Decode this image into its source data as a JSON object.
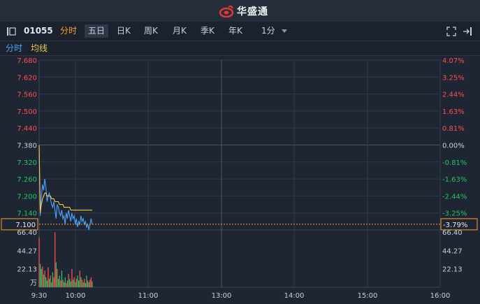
{
  "brand": {
    "name": "华盛通",
    "logo": "huasheng-logo-icon"
  },
  "toolbar": {
    "collapse_icon": "panel-collapse-icon",
    "stock_code": "01055",
    "periods": [
      "分时",
      "五日",
      "日K",
      "周K",
      "月K",
      "季K",
      "年K"
    ],
    "active_period": "分时",
    "highlight_period": "五日",
    "interval": "1分",
    "interval_arrow": "chevron-down-icon",
    "fullscreen_icon": "fullscreen-icon",
    "popout_icon": "popout-icon"
  },
  "subtabs": {
    "timeshare": "分时",
    "avg_line": "均线"
  },
  "colors": {
    "background": "#1e2633",
    "price_line": "#4da3ff",
    "avg_line": "#f2c94c",
    "up": "#ff4d4f",
    "down": "#22c55e",
    "ref_line": "#ff9d2e",
    "grid": "#2f3a4a"
  },
  "chart_data": {
    "type": "line",
    "reference_price": 7.38,
    "current_price_label": "7.100",
    "current_pct_label": "-3.79%",
    "price_ticks": [
      "7.680",
      "7.620",
      "7.560",
      "7.500",
      "7.440",
      "7.380",
      "7.320",
      "7.260",
      "7.200",
      "7.140",
      "7.100"
    ],
    "pct_ticks": [
      "4.07%",
      "3.25%",
      "2.44%",
      "1.63%",
      "0.81%",
      "0.00%",
      "-0.81%",
      "-1.63%",
      "-2.44%",
      "-3.25%"
    ],
    "price_tick_values": [
      7.68,
      7.62,
      7.56,
      7.5,
      7.44,
      7.38,
      7.32,
      7.26,
      7.2,
      7.14
    ],
    "time_labels": [
      "9:30",
      "10:00",
      "11:00",
      "13:00",
      "14:00",
      "15:00",
      "16:00"
    ],
    "volume_ticks": [
      "66.40",
      "44.27",
      "22.13"
    ],
    "volume_unit": "万",
    "volume_tick_values": [
      66.4,
      44.27,
      22.13
    ],
    "series": [
      {
        "values": [
          7.38,
          7.13,
          7.2,
          7.24,
          7.22,
          7.26,
          7.23,
          7.18,
          7.2,
          7.21,
          7.19,
          7.17,
          7.16,
          7.18,
          7.15,
          7.12,
          7.17,
          7.16,
          7.14,
          7.13,
          7.15,
          7.12,
          7.13,
          7.1,
          7.14,
          7.12,
          7.15,
          7.13,
          7.11,
          7.14,
          7.12,
          7.13,
          7.1,
          7.12,
          7.09,
          7.11,
          7.1,
          7.13,
          7.11,
          7.12,
          7.1,
          7.11,
          7.09,
          7.1,
          7.08,
          7.1,
          7.12,
          7.1
        ]
      },
      {
        "values": [
          7.38,
          7.14,
          7.17,
          7.19,
          7.2,
          7.21,
          7.21,
          7.2,
          7.2,
          7.2,
          7.2,
          7.19,
          7.19,
          7.19,
          7.18,
          7.18,
          7.18,
          7.18,
          7.17,
          7.17,
          7.17,
          7.17,
          7.16,
          7.16,
          7.16,
          7.16,
          7.16,
          7.16,
          7.15,
          7.15,
          7.15,
          7.15,
          7.15,
          7.15,
          7.15,
          7.15,
          7.15,
          7.15,
          7.15,
          7.15,
          7.15,
          7.15,
          7.15,
          7.15,
          7.15,
          7.15,
          7.15,
          7.15
        ]
      }
    ],
    "volumes": [
      60,
      28,
      22,
      25,
      15,
      20,
      12,
      8,
      24,
      10,
      14,
      6,
      18,
      12,
      66,
      30,
      22,
      10,
      14,
      8,
      20,
      9,
      6,
      12,
      5,
      8,
      16,
      10,
      7,
      22,
      9,
      12,
      6,
      10,
      14,
      8,
      20,
      12,
      9,
      6,
      10,
      5,
      14,
      8,
      6,
      9,
      12,
      7
    ],
    "volume_up": [
      true,
      false,
      false,
      true,
      false,
      true,
      false,
      false,
      true,
      false,
      true,
      false,
      false,
      true,
      true,
      false,
      true,
      false,
      false,
      true,
      false,
      true,
      false,
      false,
      true,
      false,
      true,
      false,
      false,
      true,
      false,
      true,
      false,
      true,
      false,
      false,
      true,
      false,
      true,
      false,
      true,
      false,
      false,
      true,
      false,
      true,
      true,
      false
    ]
  }
}
